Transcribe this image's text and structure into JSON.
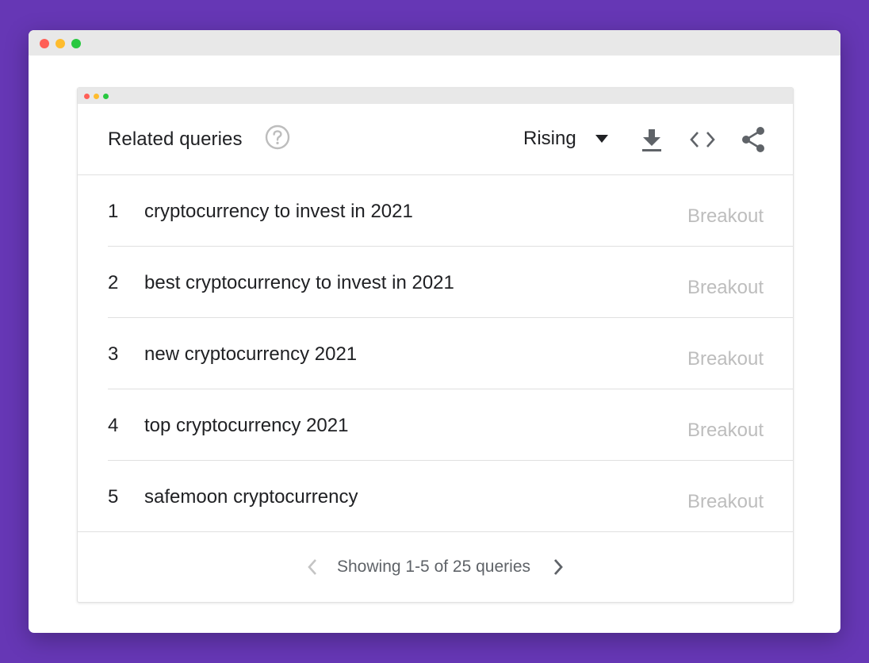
{
  "colors": {
    "background": "#6637b5",
    "window_dot_red": "#ff5f57",
    "window_dot_yellow": "#febc2e",
    "window_dot_green": "#28c840",
    "breakout_text": "#bdbdbd"
  },
  "widget": {
    "title": "Related queries",
    "help_icon": "question-circle-icon",
    "filter": {
      "selected": "Rising",
      "icon": "caret-down-icon"
    },
    "actions": [
      {
        "name": "download",
        "icon": "download-icon"
      },
      {
        "name": "embed",
        "icon": "code-brackets-icon"
      },
      {
        "name": "share",
        "icon": "share-icon"
      }
    ],
    "rows": [
      {
        "rank": "1",
        "query": "cryptocurrency to invest in 2021",
        "value": "Breakout"
      },
      {
        "rank": "2",
        "query": "best cryptocurrency to invest in 2021",
        "value": "Breakout"
      },
      {
        "rank": "3",
        "query": "new cryptocurrency 2021",
        "value": "Breakout"
      },
      {
        "rank": "4",
        "query": "top cryptocurrency 2021",
        "value": "Breakout"
      },
      {
        "rank": "5",
        "query": "safemoon cryptocurrency",
        "value": "Breakout"
      }
    ],
    "pagination": {
      "text": "Showing 1-5 of 25 queries",
      "prev_icon": "chevron-left-icon",
      "next_icon": "chevron-right-icon"
    }
  }
}
